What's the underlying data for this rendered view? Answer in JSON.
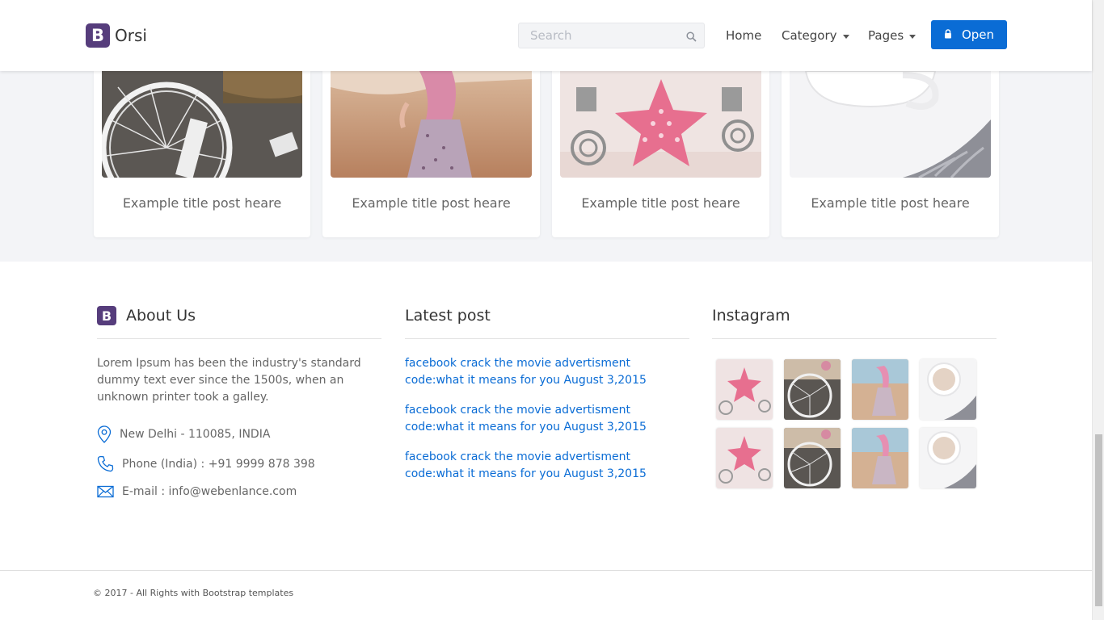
{
  "brand": {
    "logo_letter": "B",
    "name": "Orsi",
    "color": "#563d7c"
  },
  "nav": {
    "search_placeholder": "Search",
    "links": [
      {
        "label": "Home"
      },
      {
        "label": "Category",
        "dropdown": true
      },
      {
        "label": "Pages",
        "dropdown": true
      }
    ],
    "open_button": "Open",
    "accent": "#0a6cd5"
  },
  "cards": [
    {
      "title": "Example title post heare",
      "image": "bicycle-wheel-photo"
    },
    {
      "title": "Example title post heare",
      "image": "girl-on-beach-photo"
    },
    {
      "title": "Example title post heare",
      "image": "starfish-bracelet-photo"
    },
    {
      "title": "Example title post heare",
      "image": "coffee-cup-photo"
    }
  ],
  "footer": {
    "about": {
      "logo_letter": "B",
      "heading": "About Us",
      "text": "Lorem Ipsum has been the industry's standard dummy text ever since the 1500s, when an unknown printer took a galley.",
      "address": "New Delhi - 110085, INDIA",
      "phone": "Phone (India) : +91 9999 878 398",
      "email": "E-mail : info@webenlance.com"
    },
    "latest": {
      "heading": "Latest post",
      "posts": [
        "facebook crack the movie advertisment code:what it means for you August 3,2015",
        "facebook crack the movie advertisment code:what it means for you August 3,2015",
        "facebook crack the movie advertisment code:what it means for you August 3,2015"
      ]
    },
    "instagram": {
      "heading": "Instagram",
      "images": [
        "starfish-photo",
        "bicycle-photo",
        "beach-girl-photo",
        "coffee-photo",
        "starfish-photo",
        "bicycle-photo",
        "beach-girl-photo",
        "coffee-photo"
      ]
    },
    "copyright": "© 2017 - All Rights with Bootstrap templates"
  }
}
